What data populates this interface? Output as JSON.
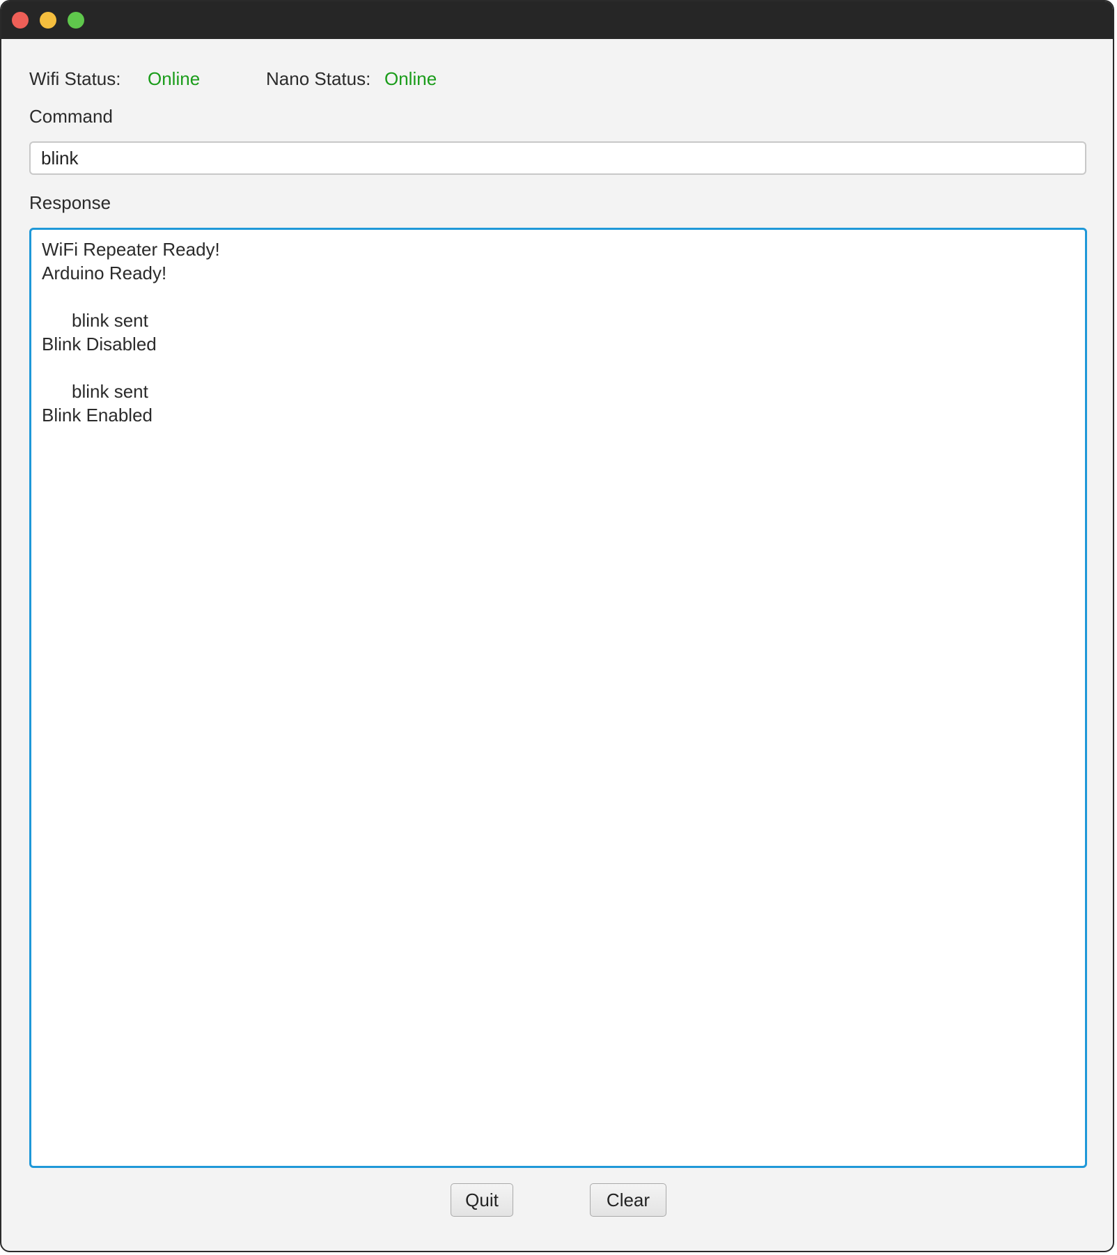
{
  "window": {
    "controls": {
      "close": "close-icon",
      "minimize": "minimize-icon",
      "zoom": "zoom-icon"
    }
  },
  "status": {
    "wifi_label": "Wifi Status:",
    "wifi_value": "Online",
    "nano_label": "Nano Status:",
    "nano_value": "Online",
    "online_color": "#1a9c1a"
  },
  "command": {
    "label": "Command",
    "value": "blink"
  },
  "response": {
    "label": "Response",
    "lines": [
      "WiFi Repeater Ready!",
      "Arduino Ready!",
      "",
      "blink sent",
      "Blink Disabled",
      "",
      "blink sent",
      "Blink Enabled"
    ],
    "focus_color": "#1f98d8"
  },
  "buttons": {
    "quit_label": "Quit",
    "clear_label": "Clear"
  }
}
